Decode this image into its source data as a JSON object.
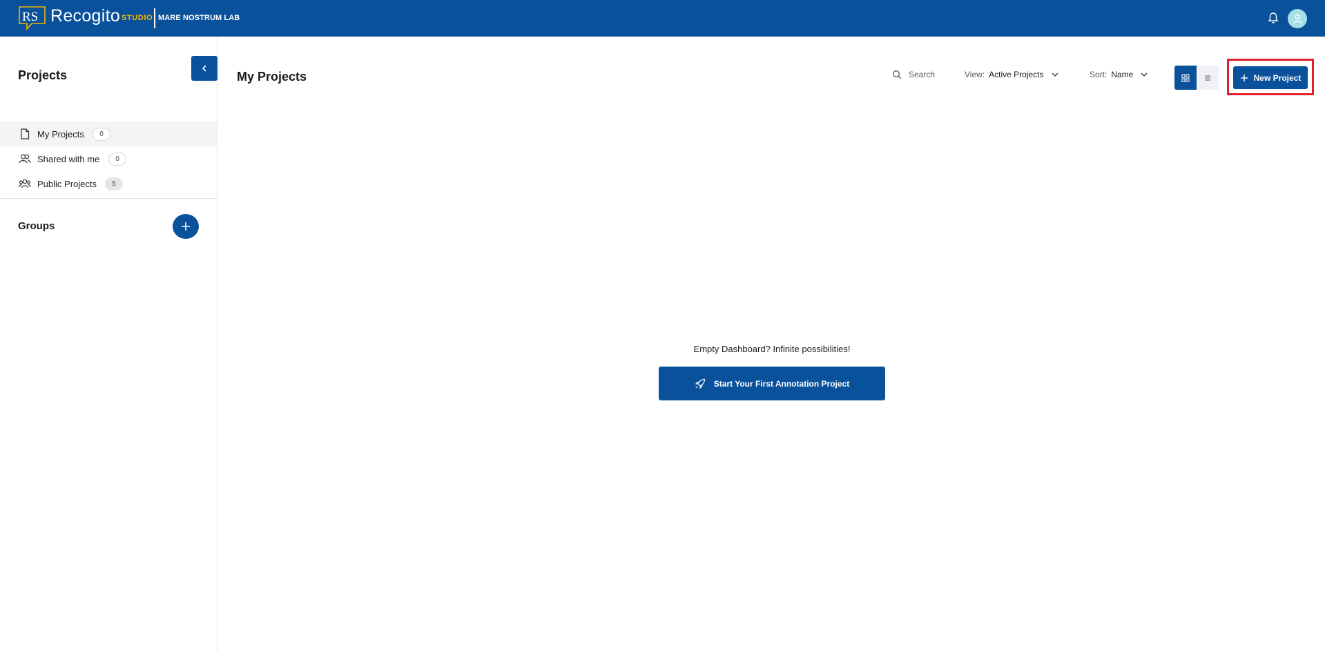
{
  "header": {
    "logo_letters": "RS",
    "app_name": "Recogito",
    "app_suffix": "STUDIO",
    "org_name": "MARE NOSTRUM LAB",
    "notifications_icon": "bell-icon",
    "avatar_icon": "user-icon"
  },
  "sidebar": {
    "title": "Projects",
    "collapse_icon": "chevron-left-icon",
    "items": [
      {
        "label": "My Projects",
        "count": "0",
        "icon": "document-icon"
      },
      {
        "label": "Shared with me",
        "count": "0",
        "icon": "users-icon"
      },
      {
        "label": "Public Projects",
        "count": "5",
        "icon": "group-icon"
      }
    ],
    "groups_title": "Groups",
    "add_group_icon": "plus-icon"
  },
  "main": {
    "title": "My Projects",
    "search_placeholder": "Search",
    "view_label": "View:",
    "view_value": "Active Projects",
    "sort_label": "Sort:",
    "sort_value": "Name",
    "new_project_label": "New Project",
    "empty_message": "Empty Dashboard? Infinite possibilities!",
    "start_button_label": "Start Your First Annotation Project"
  },
  "colors": {
    "brand": "#0a519c",
    "accent": "#f5b400",
    "highlight": "#e0202b"
  }
}
